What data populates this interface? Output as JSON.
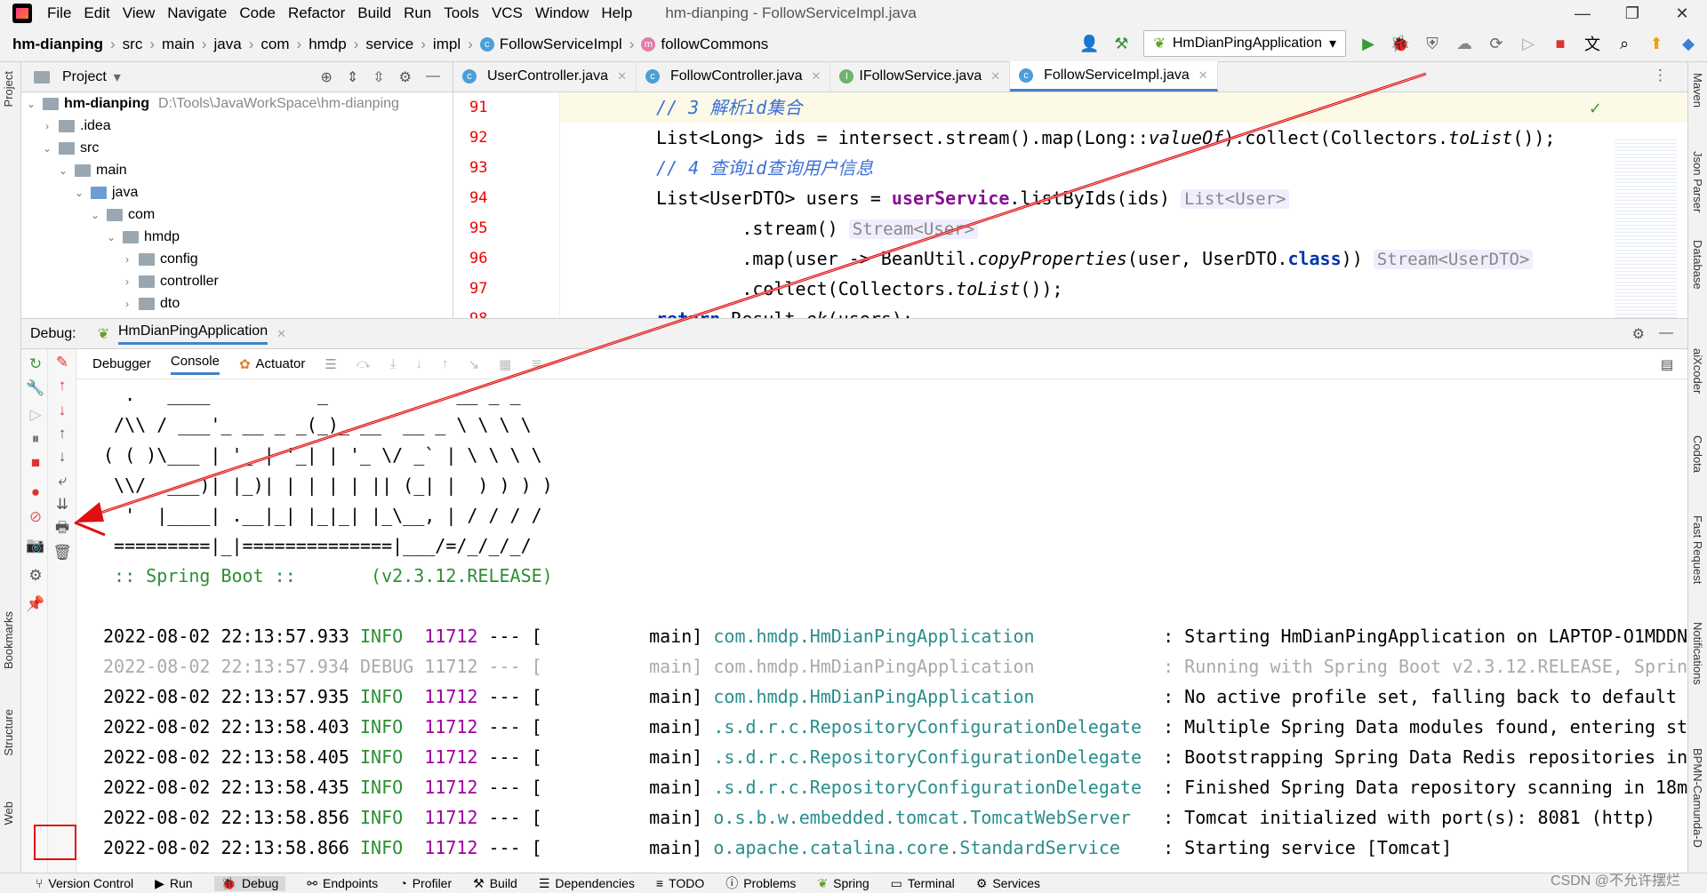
{
  "menu": {
    "items": [
      "File",
      "Edit",
      "View",
      "Navigate",
      "Code",
      "Refactor",
      "Build",
      "Run",
      "Tools",
      "VCS",
      "Window",
      "Help"
    ],
    "window_title": "hm-dianping - FollowServiceImpl.java"
  },
  "breadcrumb": {
    "items": [
      "hm-dianping",
      "src",
      "main",
      "java",
      "com",
      "hmdp",
      "service",
      "impl",
      "FollowServiceImpl",
      "followCommons"
    ]
  },
  "run_config": {
    "label": "HmDianPingApplication"
  },
  "project": {
    "title": "Project",
    "tree": [
      {
        "label": "hm-dianping",
        "extra": "D:\\Tools\\JavaWorkSpace\\hm-dianping"
      },
      {
        "label": ".idea"
      },
      {
        "label": "src"
      },
      {
        "label": "main"
      },
      {
        "label": "java"
      },
      {
        "label": "com"
      },
      {
        "label": "hmdp"
      },
      {
        "label": "config"
      },
      {
        "label": "controller"
      },
      {
        "label": "dto"
      }
    ]
  },
  "editor": {
    "tabs": [
      "UserController.java",
      "FollowController.java",
      "IFollowService.java",
      "FollowServiceImpl.java"
    ],
    "line_numbers": [
      "91",
      "92",
      "93",
      "94",
      "95",
      "96",
      "97",
      "98"
    ],
    "code": {
      "l91": "// 3 解析id集合",
      "l92a": "List<Long> ids = intersect.stream().map(Long::",
      "l92b": "valueOf",
      "l92c": ").collect(Collectors.",
      "l92d": "toList",
      "l92e": "());",
      "l93": "// 4 查询id查询用户信息",
      "l94a": "List<UserDTO> users = ",
      "l94b": "userService",
      "l94c": ".listByIds(ids)",
      "l94hint": "List<User>",
      "l95a": "        .stream()",
      "l95hint": "Stream<User>",
      "l96a": "        .map(user -> BeanUtil.",
      "l96b": "copyProperties",
      "l96c": "(user, UserDTO.",
      "l96d": "class",
      "l96e": "))",
      "l96hint": "Stream<UserDTO>",
      "l97a": "        .collect(Collectors.",
      "l97b": "toList",
      "l97c": "());",
      "l98a": "return",
      "l98b": " Result.",
      "l98c": "ok",
      "l98d": "(users);"
    }
  },
  "debug": {
    "label": "Debug:",
    "session": "HmDianPingApplication",
    "tabs": [
      "Debugger",
      "Console",
      "Actuator"
    ],
    "banner": [
      "  .   ____          _            __ _ _",
      " /\\\\ / ___'_ __ _ _(_)_ __  __ _ \\ \\ \\ \\",
      "( ( )\\___ | '_ | '_| | '_ \\/ _` | \\ \\ \\ \\",
      " \\\\/  ___)| |_)| | | | | || (_| |  ) ) ) )",
      "  '  |____| .__|_| |_|_| |_\\__, | / / / /",
      " =========|_|==============|___/=/_/_/_/",
      " :: Spring Boot ::       (v2.3.12.RELEASE)"
    ],
    "logs": [
      {
        "ts": "2022-08-02 22:13:57.933",
        "level": "INFO ",
        "pid": "11712",
        "thread": "main]",
        "logger": "com.hmdp.HmDianPingApplication           ",
        "msg": ": Starting HmDianPingApplication on LAPTOP-O1MDDN",
        "dim": false
      },
      {
        "ts": "2022-08-02 22:13:57.934",
        "level": "DEBUG",
        "pid": "11712",
        "thread": "main]",
        "logger": "com.hmdp.HmDianPingApplication           ",
        "msg": ": Running with Spring Boot v2.3.12.RELEASE, Sprin",
        "dim": true
      },
      {
        "ts": "2022-08-02 22:13:57.935",
        "level": "INFO ",
        "pid": "11712",
        "thread": "main]",
        "logger": "com.hmdp.HmDianPingApplication           ",
        "msg": ": No active profile set, falling back to default",
        "dim": false
      },
      {
        "ts": "2022-08-02 22:13:58.403",
        "level": "INFO ",
        "pid": "11712",
        "thread": "main]",
        "logger": ".s.d.r.c.RepositoryConfigurationDelegate ",
        "msg": ": Multiple Spring Data modules found, entering st",
        "dim": false
      },
      {
        "ts": "2022-08-02 22:13:58.405",
        "level": "INFO ",
        "pid": "11712",
        "thread": "main]",
        "logger": ".s.d.r.c.RepositoryConfigurationDelegate ",
        "msg": ": Bootstrapping Spring Data Redis repositories in",
        "dim": false
      },
      {
        "ts": "2022-08-02 22:13:58.435",
        "level": "INFO ",
        "pid": "11712",
        "thread": "main]",
        "logger": ".s.d.r.c.RepositoryConfigurationDelegate ",
        "msg": ": Finished Spring Data repository scanning in 18m",
        "dim": false
      },
      {
        "ts": "2022-08-02 22:13:58.856",
        "level": "INFO ",
        "pid": "11712",
        "thread": "main]",
        "logger": "o.s.b.w.embedded.tomcat.TomcatWebServer  ",
        "msg": ": Tomcat initialized with port(s): 8081 (http)",
        "dim": false
      },
      {
        "ts": "2022-08-02 22:13:58.866",
        "level": "INFO ",
        "pid": "11712",
        "thread": "main]",
        "logger": "o.apache.catalina.core.StandardService   ",
        "msg": ": Starting service [Tomcat]",
        "dim": false
      }
    ]
  },
  "left_strip": {
    "labels": [
      "Project",
      "Bookmarks",
      "Structure",
      "Web"
    ]
  },
  "right_strip": {
    "labels": [
      "Maven",
      "Json Parser",
      "Database",
      "aiXcoder",
      "Codota",
      "Fast Request",
      "Notifications",
      "BPMN-Camunda-D"
    ]
  },
  "bottom_tools": [
    "Version Control",
    "Run",
    "Debug",
    "Endpoints",
    "Profiler",
    "Build",
    "Dependencies",
    "TODO",
    "Problems",
    "Spring",
    "Terminal",
    "Services"
  ],
  "watermark": "CSDN @不允许摆烂",
  "colors": {
    "accent": "#4083c9",
    "annotation": "#e01010"
  }
}
